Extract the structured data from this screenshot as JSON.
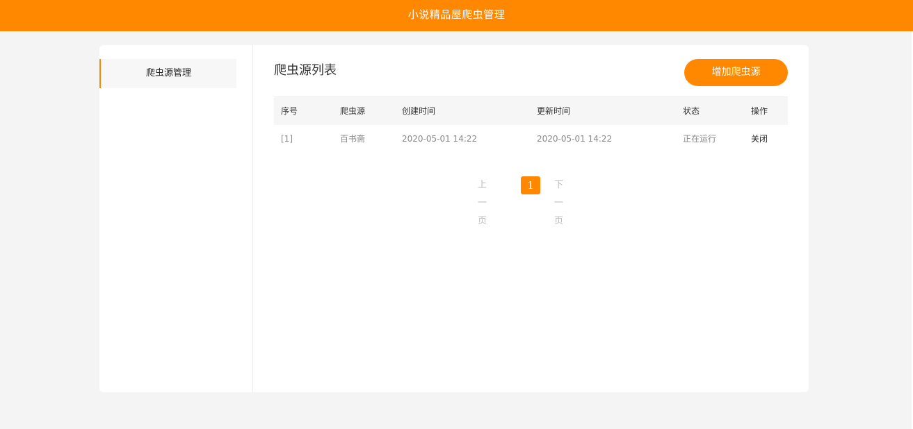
{
  "header": {
    "title": "小说精品屋爬虫管理"
  },
  "sidebar": {
    "items": [
      {
        "label": "爬虫源管理"
      }
    ]
  },
  "main": {
    "title": "爬虫源列表",
    "add_button": "增加爬虫源",
    "table": {
      "columns": [
        "序号",
        "爬虫源",
        "创建时间",
        "更新时间",
        "状态",
        "操作"
      ],
      "rows": [
        {
          "index": "[1]",
          "source": "百书斋",
          "created": "2020-05-01 14:22",
          "updated": "2020-05-01 14:22",
          "status": "正在运行",
          "action": "关闭"
        }
      ]
    },
    "pagination": {
      "prev": "上一页",
      "current": "1",
      "next": "下一页"
    }
  },
  "colors": {
    "accent": "#ff8800",
    "background": "#f4f4f4"
  }
}
